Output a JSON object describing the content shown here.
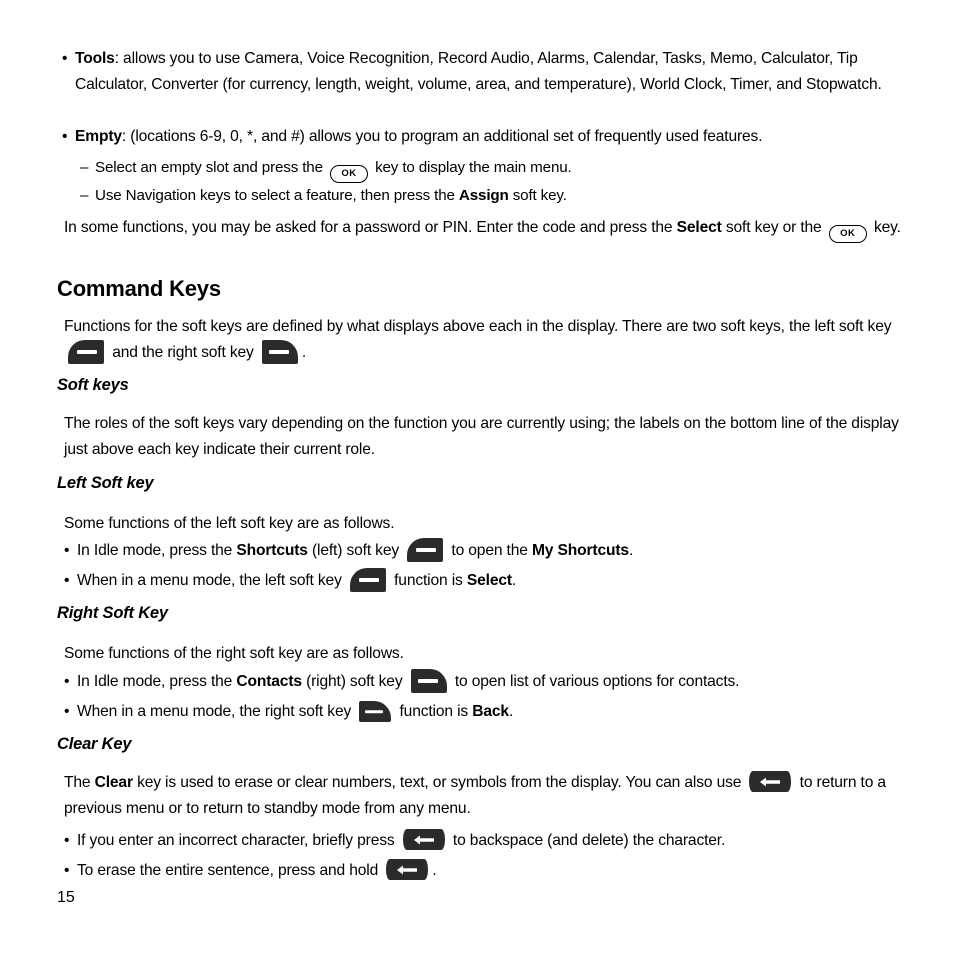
{
  "document": {
    "page_number": "15",
    "background_color": "#ffffff",
    "text_color": "#000000",
    "icon_color": "#2b2b2b"
  },
  "icons": {
    "ok_key_label": "OK",
    "ok_key_name": "ok-key-icon",
    "left_soft_key_name": "left-soft-key-icon",
    "right_soft_key_name": "right-soft-key-icon",
    "clear_key_name": "clear-key-icon"
  },
  "top_list": {
    "items": [
      {
        "bullet": "•",
        "term": "Tools",
        "text_after_term": ": allows you to use Camera, Voice Recognition, Record Audio, Alarms, Calendar, Tasks, Memo, Calculator, Tip Calculator, Converter (for currency, length, weight, volume, area, and temperature), World Clock, Timer, and Stopwatch."
      },
      {
        "bullet": "•",
        "term": "Empty",
        "text_after_term": ": (locations 6-9, 0, *, and #) allows you to program an additional set of frequently used features."
      }
    ],
    "sub_items": [
      {
        "dash": "–",
        "before_icon": "Select an empty slot and press the",
        "after_icon": "key to display the main menu."
      },
      {
        "dash": "–",
        "before_bold": "Use Navigation keys to select a feature, then press the",
        "bold": "Assign",
        "after_bold": "soft key."
      }
    ]
  },
  "password_para": {
    "part1": "In some functions, you may be asked for a password or PIN. Enter the code and press the",
    "bold1": "Select",
    "part2": "soft key or the",
    "part3": "key."
  },
  "command_keys": {
    "heading": "Command Keys",
    "intro": {
      "part1": "Functions for the soft keys are defined by what displays above each in the display. There are two soft keys, the left soft key",
      "part2": "and the right soft key",
      "part3": "."
    },
    "soft_keys": {
      "heading": "Soft keys",
      "paragraph": "The roles of the soft keys vary depending on the function you are currently using; the labels on the bottom line of the display just above each key indicate their current role."
    },
    "left_soft_key": {
      "heading": "Left Soft key",
      "paragraph": "Some functions of the left soft key are as follows.",
      "bullets": [
        {
          "bullet": "•",
          "part1": "In Idle mode, press the",
          "bold1": "Shortcuts",
          "part2": "(left) soft key",
          "part3": "to open the",
          "bold2": "My Shortcuts",
          "part4": "."
        },
        {
          "bullet": "•",
          "part1": "When in a menu mode, the left soft key",
          "part2": "",
          "part3": "function is",
          "bold2": "Select",
          "part4": "."
        }
      ]
    },
    "right_soft_key": {
      "heading": "Right Soft Key",
      "paragraph": "Some functions of the right soft key are as follows.",
      "bullets": [
        {
          "bullet": "•",
          "part1": "In Idle mode, press the",
          "bold1": "Contacts",
          "part2": "(right) soft key",
          "part3": "to open list of various options for contacts.",
          "bold2": "",
          "part4": ""
        },
        {
          "bullet": "•",
          "part1": "When in a menu mode, the right soft key",
          "part2": "",
          "part3": "function is",
          "bold2": "Back",
          "part4": "."
        }
      ]
    },
    "clear_key": {
      "heading": "Clear Key",
      "paragraph": {
        "part1": "The",
        "bold1": "Clear",
        "part2": "key is used to erase or clear numbers, text, or symbols from the display. You can also use",
        "part3": "to return to a previous menu or to return to standby mode from any menu."
      },
      "bullets": [
        {
          "bullet": "•",
          "part1": "If you enter an incorrect character, briefly press",
          "part2": "to backspace (and delete) the character."
        },
        {
          "bullet": "•",
          "part1": "To erase the entire sentence, press and hold",
          "part2": "."
        }
      ]
    }
  }
}
